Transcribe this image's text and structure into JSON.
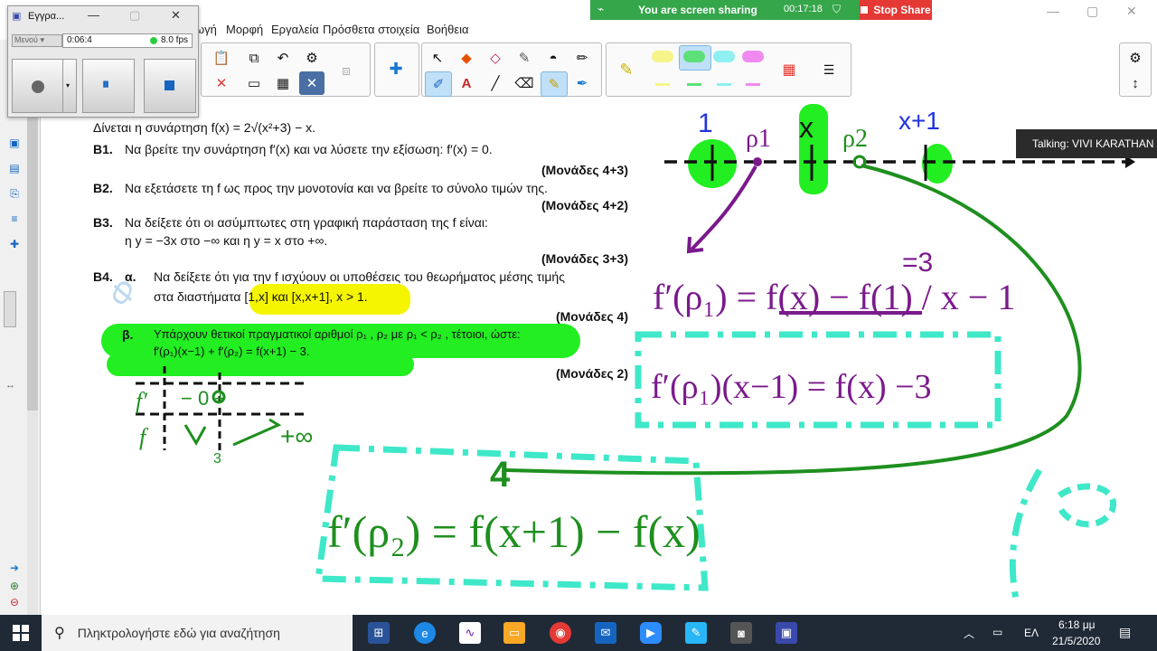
{
  "menubar": {
    "items": [
      "ωγή",
      "Μορφή",
      "Εργαλεία",
      "Πρόσθετα στοιχεία",
      "Βοήθεια"
    ]
  },
  "share": {
    "status": "You are screen sharing",
    "time": "00:17:18",
    "stop_label": "Stop Share"
  },
  "recorder": {
    "title": "Εγγρα...",
    "mode": "Μενού",
    "time": "0:06:4",
    "fps": "8.0 fps"
  },
  "document": {
    "intro": "Δίνεται η συνάρτηση  f(x) = 2√(x²+3) − x.",
    "b1_label": "Β1.",
    "b1_text": "Να βρείτε την συνάρτηση f′(x) και να λύσετε την εξίσωση:  f′(x) = 0.",
    "b1_points": "(Μονάδες 4+3)",
    "b2_label": "Β2.",
    "b2_text": "Να εξετάσετε τη f ως προς την μονοτονία και να βρείτε το σύνολο τιμών της.",
    "b2_points": "(Μονάδες 4+2)",
    "b3_label": "Β3.",
    "b3_text": "Να δείξετε ότι οι ασύμπτωτες στη γραφική παράσταση της f είναι:",
    "b3_text2": "η  y = −3x  στο  −∞  και η  y = x  στο  +∞.",
    "b3_points": "(Μονάδες 3+3)",
    "b4_label": "Β4.",
    "b4a_label": "α.",
    "b4a_text": "Να δείξετε ότι για την f ισχύουν οι υποθέσεις του θεωρήματος μέσης τιμής",
    "b4a_text2": "στα διαστήματα [1,x] και [x,x+1], x > 1.",
    "b4a_points": "(Μονάδες 4)",
    "b4b_label": "β.",
    "b4b_text": "Υπάρχουν θετικοί πραγματικοί αριθμοί ρ₁ , ρ₂  με ρ₁ < ρ₂ , τέτοιοι, ώστε:",
    "b4b_text2": "f′(ρ₁)(x−1) + f′(ρ₂) = f(x+1) − 3.",
    "b4b_points": "(Μονάδες 2)"
  },
  "talking": "Talking: VIVI KARATHAN",
  "annotations": {
    "num_line_1": "1",
    "num_line_x": "x",
    "num_line_xp1": "x+1",
    "rho1": "ρ1",
    "rho2": "ρ2",
    "eq1": "f′(ρ₁) = f(x) − f(1) / x − 1",
    "eq1_sup": "=3",
    "eq2": "f′(ρ₁)(x−1) = f(x) −3",
    "eq3": "f′(ρ₂) = f(x+1) − f(x)",
    "num4": "4",
    "table_label_fp": "f′",
    "table_label_f": "f",
    "table_signs": "−  0  +",
    "table_val": "3",
    "table_inf": "+∞"
  },
  "taskbar": {
    "search_placeholder": "Πληκτρολογήστε εδώ για αναζήτηση",
    "lang": "ΕΛ",
    "time": "6:18 μμ",
    "date": "21/5/2020"
  },
  "colors": {
    "ink_green": "#1e8f1e",
    "highlight_green": "#22ee22",
    "highlight_yellow": "#f5f500",
    "ink_purple": "#7a1a8c",
    "ink_cyan": "#3ee8c8",
    "ink_blue": "#2233dd"
  }
}
